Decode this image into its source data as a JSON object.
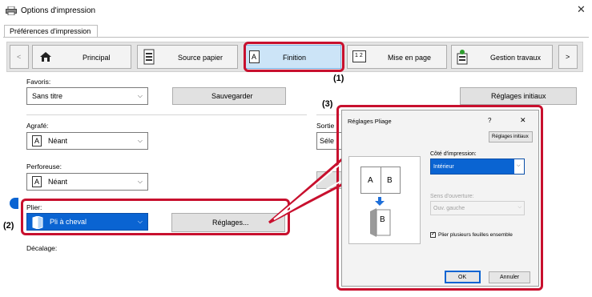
{
  "window": {
    "title": "Options d'impression",
    "close_glyph": "✕"
  },
  "tabs": [
    {
      "label": "Préférences d'impression",
      "selected": true
    }
  ],
  "nav": {
    "left_arrow": "<",
    "right_arrow": ">",
    "items": [
      {
        "label": "Principal",
        "icon": "home-icon",
        "selected": false
      },
      {
        "label": "Source papier",
        "icon": "paper-source-icon",
        "selected": false
      },
      {
        "label": "Finition",
        "icon": "finishing-icon",
        "icon_letter": "A",
        "selected": true
      },
      {
        "label": "Mise en page",
        "icon": "layout-icon",
        "icon_text": "1 2",
        "selected": false
      },
      {
        "label": "Gestion travaux",
        "icon": "job-handling-icon",
        "selected": false
      }
    ]
  },
  "favorites": {
    "label": "Favoris:",
    "value": "Sans titre",
    "save_button": "Sauvegarder",
    "defaults_button": "Réglages initiaux"
  },
  "staple": {
    "label": "Agrafé:",
    "icon_letter": "A",
    "value": "Néant"
  },
  "punch": {
    "label": "Perforeuse:",
    "icon_letter": "A",
    "value": "Néant"
  },
  "fold": {
    "label": "Plier:",
    "value": "Pli à cheval",
    "settings_button": "Réglages..."
  },
  "offset": {
    "label": "Décalage:"
  },
  "output": {
    "label_partial": "Sortie",
    "value_partial": "Séle"
  },
  "callouts": {
    "c1": "(1)",
    "c2": "(2)",
    "c3": "(3)"
  },
  "dialog": {
    "title": "Réglages Pliage",
    "help_glyph": "?",
    "close_glyph": "✕",
    "defaults_button": "Réglages initiaux",
    "print_side_label": "Côté d'impression:",
    "print_side_value": "Intérieur",
    "opening_label": "Sens d'ouverture:",
    "opening_value": "Ouv. gauche",
    "multi_sheet_label": "Plier plusieurs feuilles ensemble",
    "multi_sheet_checked": true,
    "preview_letters": [
      "A",
      "B"
    ],
    "ok": "OK",
    "cancel": "Annuler"
  },
  "colors": {
    "accent_blue": "#0a64d2",
    "selected_tab_blue": "#cce4f7",
    "callout_red": "#c8102e",
    "arrow_blue": "#1e6fd9"
  }
}
